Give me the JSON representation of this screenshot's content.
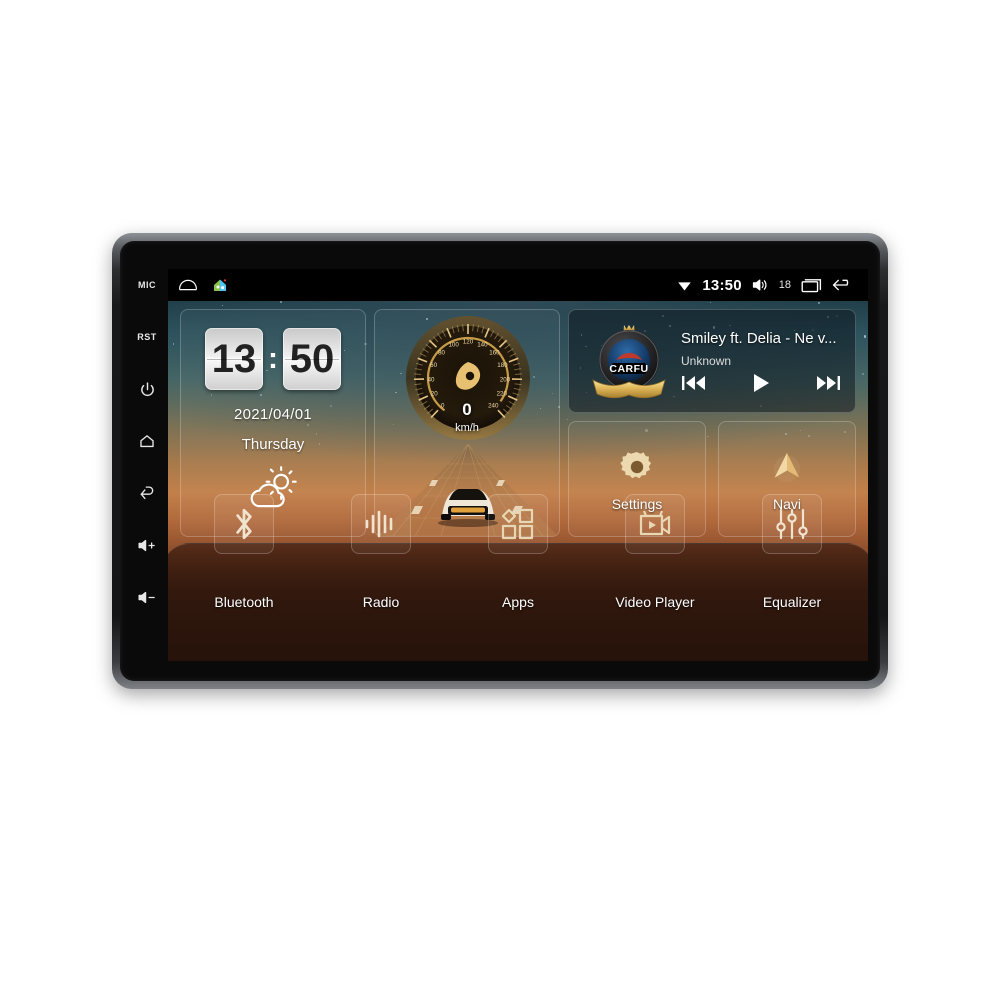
{
  "device": {
    "hardware_keys": [
      {
        "name": "mic-key",
        "label": "MIC",
        "icon": "text"
      },
      {
        "name": "reset-key",
        "label": "RST",
        "icon": "text"
      },
      {
        "name": "power-key",
        "label": "",
        "icon": "power-icon"
      },
      {
        "name": "home-key",
        "label": "",
        "icon": "home-icon"
      },
      {
        "name": "back-key",
        "label": "",
        "icon": "back-icon"
      },
      {
        "name": "volume-up-key",
        "label": "",
        "icon": "volume-up-icon"
      },
      {
        "name": "volume-down-key",
        "label": "",
        "icon": "volume-down-icon"
      }
    ]
  },
  "statusbar": {
    "home_icon": "home-outline-icon",
    "app_icon": "app-shortcut-icon",
    "wifi_icon": "wifi-icon",
    "time": "13:50",
    "volume_icon": "volume-icon",
    "volume_level": "18",
    "recents_icon": "recents-icon",
    "back_icon": "back-arrow-icon"
  },
  "widgets": {
    "clock": {
      "hours": "13",
      "minutes": "50",
      "separator": ":",
      "date": "2021/04/01",
      "weekday": "Thursday",
      "weather_icon": "partly-cloudy-icon"
    },
    "speedometer": {
      "value": "0",
      "unit": "km/h",
      "ticks": [
        "0",
        "20",
        "40",
        "60",
        "80",
        "100",
        "120",
        "140",
        "160",
        "180",
        "200",
        "220",
        "240"
      ],
      "min": 0,
      "max": 240
    },
    "music": {
      "album_art": "carfu-badge-icon",
      "album_art_text": "CARFU",
      "track": "Smiley ft. Delia - Ne v...",
      "artist": "Unknown",
      "prev_label": "previous-track",
      "play_label": "play",
      "next_label": "next-track"
    },
    "tiles": [
      {
        "name": "settings",
        "label": "Settings",
        "icon": "gear-icon"
      },
      {
        "name": "navi",
        "label": "Navi",
        "icon": "navigation-arrow-icon"
      }
    ]
  },
  "dock": {
    "items": [
      {
        "name": "bluetooth",
        "label": "Bluetooth",
        "icon": "bluetooth-icon"
      },
      {
        "name": "radio",
        "label": "Radio",
        "icon": "radio-waves-icon"
      },
      {
        "name": "apps",
        "label": "Apps",
        "icon": "apps-grid-icon"
      },
      {
        "name": "video-player",
        "label": "Video Player",
        "icon": "video-camera-icon"
      },
      {
        "name": "equalizer",
        "label": "Equalizer",
        "icon": "equalizer-sliders-icon"
      }
    ]
  },
  "colors": {
    "accent_gold": "#e2b878",
    "bezel": "#17181a",
    "statusbar_bg": "#000000",
    "text_primary": "#ffffff"
  }
}
